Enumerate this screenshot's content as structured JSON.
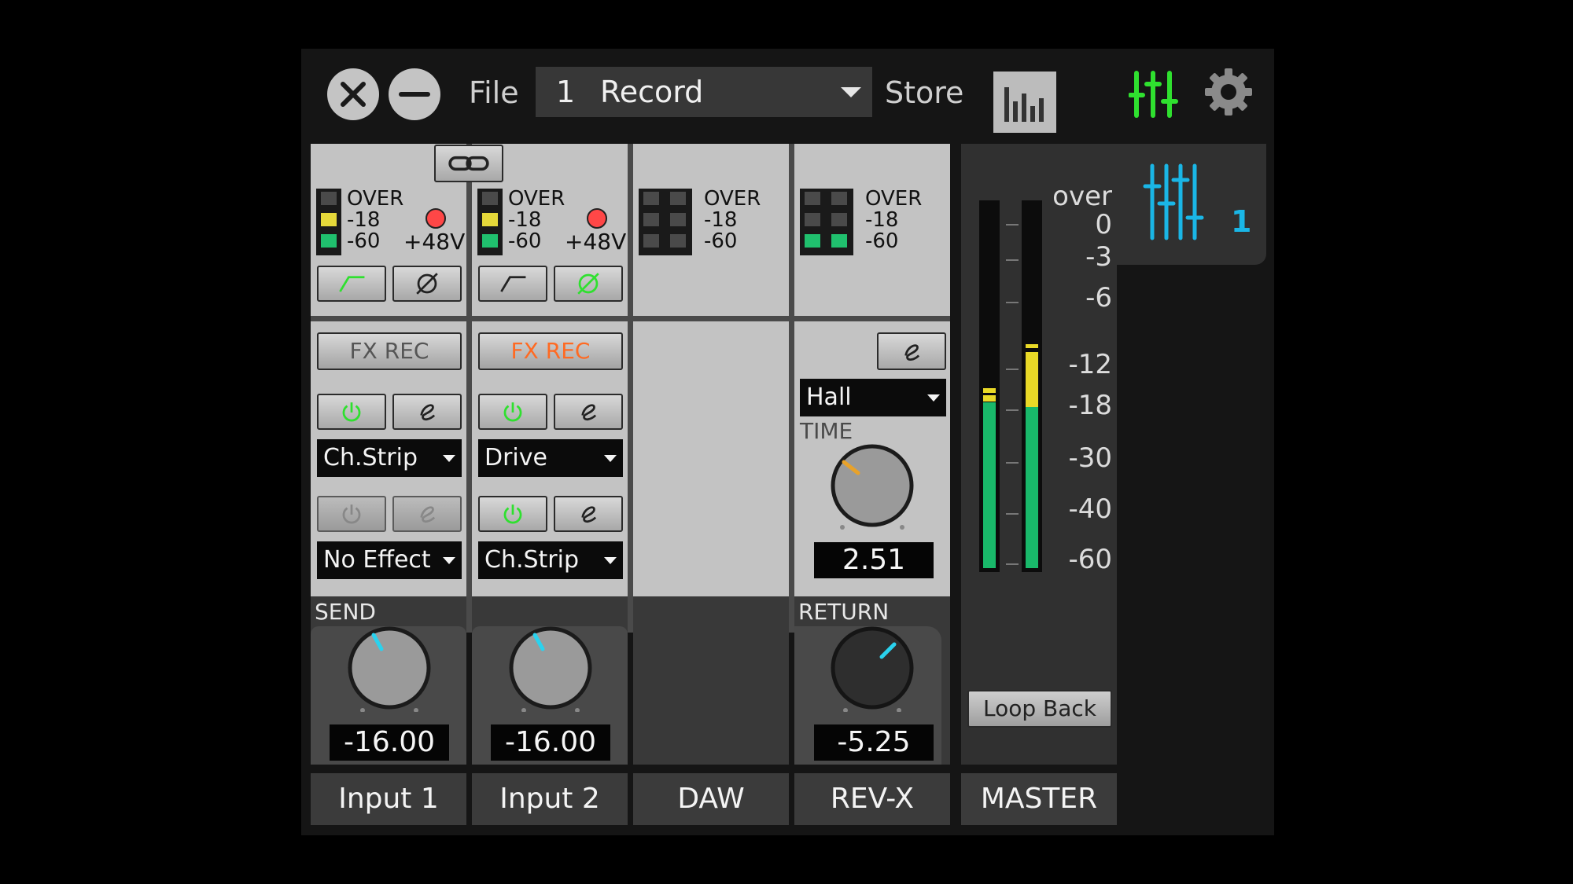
{
  "topbar": {
    "file_label": "File",
    "scene_number": "1",
    "scene_name": "Record",
    "store_label": "Store",
    "colors": {
      "mixer_icon": "#2fe02f",
      "settings_icon": "#8a8a8a"
    }
  },
  "meter_labels": {
    "over": "OVER",
    "minus18": "-18",
    "minus60": "-60"
  },
  "channels": [
    {
      "name": "Input 1",
      "phantom_label": "+48V",
      "phantom_on": true,
      "phase_icon_active": false,
      "fx_rec": {
        "label": "FX REC",
        "on": false
      },
      "effect1": {
        "power_on": true,
        "name": "Ch.Strip"
      },
      "effect2": {
        "power_on": false,
        "name": "No Effect"
      },
      "send": {
        "label": "SEND",
        "value": "-16.00"
      }
    },
    {
      "name": "Input 2",
      "phantom_label": "+48V",
      "phantom_on": true,
      "phase_icon_active": true,
      "fx_rec": {
        "label": "FX REC",
        "on": true
      },
      "effect1": {
        "power_on": true,
        "name": "Drive"
      },
      "effect2": {
        "power_on": true,
        "name": "Ch.Strip"
      },
      "send": {
        "value": "-16.00"
      }
    },
    {
      "name": "DAW"
    },
    {
      "name": "REV-X",
      "reverb_type": "Hall",
      "time_label": "TIME",
      "time_value": "2.51",
      "return": {
        "label": "RETURN",
        "value": "-5.25"
      }
    }
  ],
  "master": {
    "name": "MASTER",
    "scale_labels": [
      "over",
      "0",
      "-3",
      "-6",
      "-12",
      "-18",
      "-30",
      "-40",
      "-60"
    ],
    "loop_back_label": "Loop Back",
    "mixer_number": "1",
    "colors": {
      "meter_green": "#19b86a",
      "meter_yellow": "#e9d927",
      "tab_icon": "#1ab6e6"
    }
  }
}
